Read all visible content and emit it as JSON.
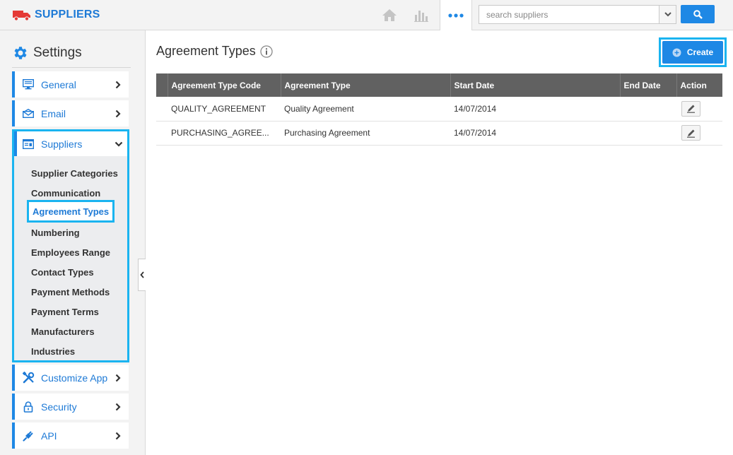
{
  "brand": {
    "title": "SUPPLIERS",
    "logo_icon": "truck-icon",
    "color": "#1e7ad6"
  },
  "header": {
    "icons": [
      "home-icon",
      "bar-chart-icon",
      "more-dots-icon"
    ],
    "search": {
      "placeholder": "search suppliers",
      "value": ""
    }
  },
  "sidebar": {
    "title": "Settings",
    "items": [
      {
        "label": "General",
        "icon": "monitor-icon"
      },
      {
        "label": "Email",
        "icon": "envelope-icon"
      },
      {
        "label": "Suppliers",
        "icon": "form-icon",
        "expanded": true,
        "subitems": [
          "Supplier Categories",
          "Communication",
          "Agreement Types",
          "Numbering",
          "Employees Range",
          "Contact Types",
          "Payment Methods",
          "Payment Terms",
          "Manufacturers",
          "Industries"
        ],
        "active_subitem": "Agreement Types"
      },
      {
        "label": "Customize App",
        "icon": "tools-icon"
      },
      {
        "label": "Security",
        "icon": "lock-icon"
      },
      {
        "label": "API",
        "icon": "plug-icon"
      }
    ]
  },
  "main": {
    "title": "Agreement Types",
    "create_label": "Create",
    "table": {
      "columns": [
        "",
        "Agreement Type Code",
        "Agreement Type",
        "Start Date",
        "End Date",
        "Action"
      ],
      "rows": [
        {
          "code": "QUALITY_AGREEMENT",
          "type": "Quality Agreement",
          "start": "14/07/2014",
          "end": ""
        },
        {
          "code": "PURCHASING_AGREE...",
          "type": "Purchasing Agreement",
          "start": "14/07/2014",
          "end": ""
        }
      ]
    }
  },
  "colors": {
    "accent": "#1e88e5",
    "highlight": "#1ab4f0",
    "header_bg": "#616161"
  }
}
